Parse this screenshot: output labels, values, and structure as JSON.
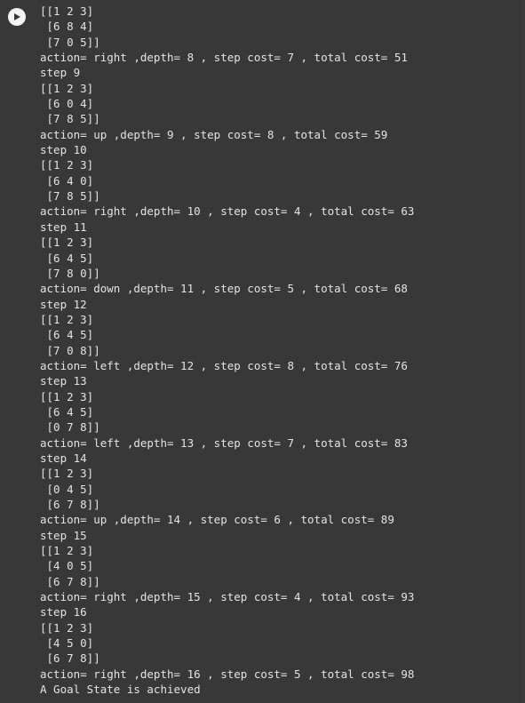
{
  "run_button": {
    "icon": "play-icon",
    "color": "#f4f4f4"
  },
  "output": {
    "lines": [
      "[[1 2 3]",
      " [6 8 4]",
      " [7 0 5]]",
      "action= right ,depth= 8 , step cost= 7 , total cost= 51",
      "step 9",
      "[[1 2 3]",
      " [6 0 4]",
      " [7 8 5]]",
      "action= up ,depth= 9 , step cost= 8 , total cost= 59",
      "step 10",
      "[[1 2 3]",
      " [6 4 0]",
      " [7 8 5]]",
      "action= right ,depth= 10 , step cost= 4 , total cost= 63",
      "step 11",
      "[[1 2 3]",
      " [6 4 5]",
      " [7 8 0]]",
      "action= down ,depth= 11 , step cost= 5 , total cost= 68",
      "step 12",
      "[[1 2 3]",
      " [6 4 5]",
      " [7 0 8]]",
      "action= left ,depth= 12 , step cost= 8 , total cost= 76",
      "step 13",
      "[[1 2 3]",
      " [6 4 5]",
      " [0 7 8]]",
      "action= left ,depth= 13 , step cost= 7 , total cost= 83",
      "step 14",
      "[[1 2 3]",
      " [0 4 5]",
      " [6 7 8]]",
      "action= up ,depth= 14 , step cost= 6 , total cost= 89",
      "step 15",
      "[[1 2 3]",
      " [4 0 5]",
      " [6 7 8]]",
      "action= right ,depth= 15 , step cost= 4 , total cost= 93",
      "step 16",
      "[[1 2 3]",
      " [4 5 0]",
      " [6 7 8]]",
      "action= right ,depth= 16 , step cost= 5 , total cost= 98",
      "A Goal State is achieved"
    ]
  }
}
